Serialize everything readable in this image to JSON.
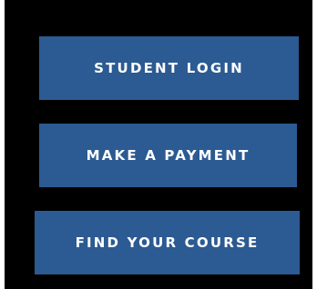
{
  "buttons": {
    "student_login": "STUDENT LOGIN",
    "make_payment": "MAKE A PAYMENT",
    "find_course": "FIND YOUR COURSE"
  },
  "colors": {
    "panel_background": "#000000",
    "button_background": "#2c5a92",
    "button_text": "#ffffff"
  }
}
